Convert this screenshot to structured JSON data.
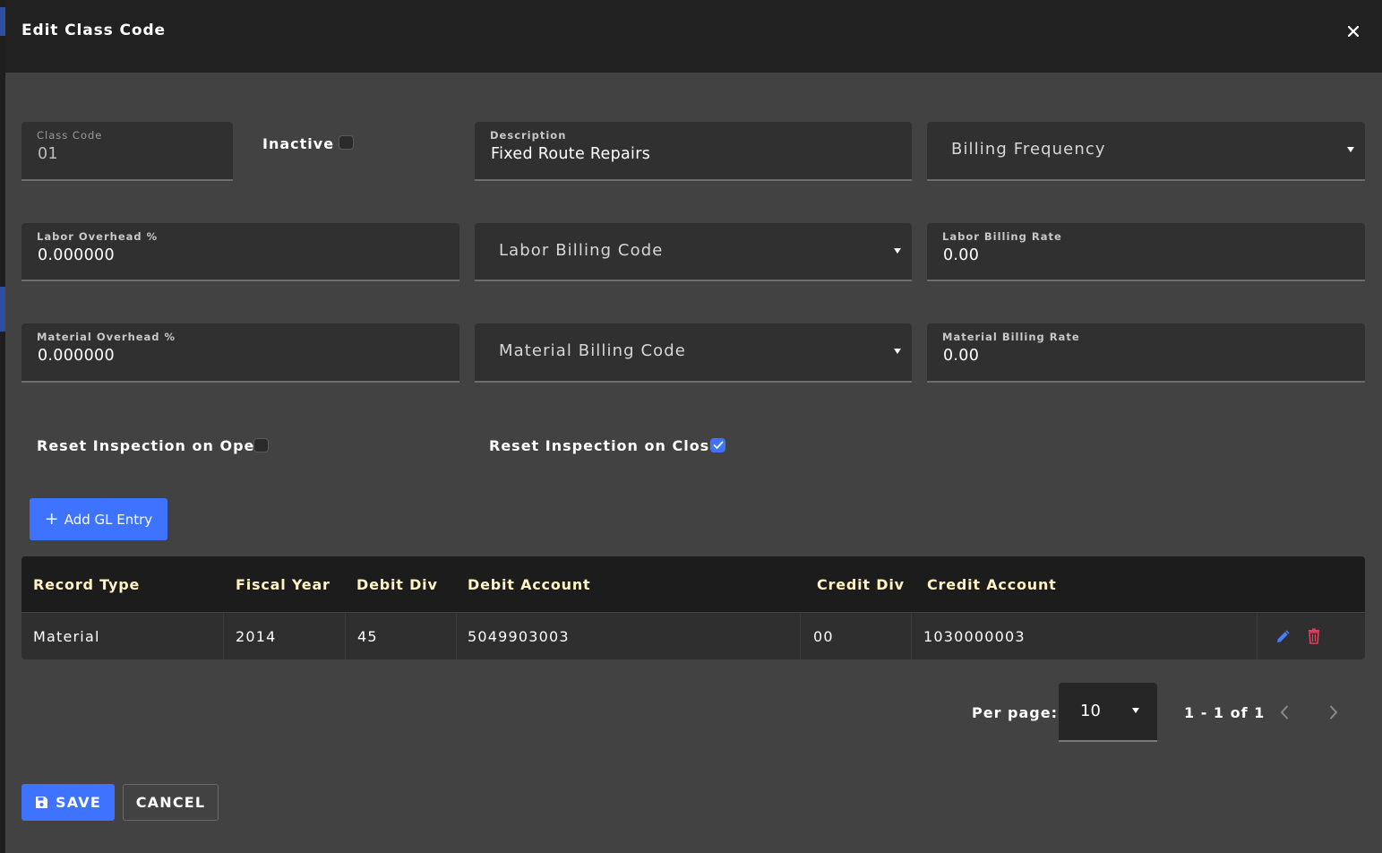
{
  "dialog": {
    "title": "Edit Class Code"
  },
  "form": {
    "class_code": {
      "label": "Class Code",
      "value": "01"
    },
    "inactive": {
      "label": "Inactive",
      "checked": false
    },
    "description": {
      "label": "Description",
      "value": "Fixed Route Repairs"
    },
    "billing_frequency": {
      "placeholder": "Billing Frequency"
    },
    "labor_overhead": {
      "label": "Labor Overhead %",
      "value": "0.000000"
    },
    "labor_billing_code": {
      "placeholder": "Labor Billing Code"
    },
    "labor_billing_rate": {
      "label": "Labor Billing Rate",
      "value": "0.00"
    },
    "material_overhead": {
      "label": "Material Overhead %",
      "value": "0.000000"
    },
    "material_billing_code": {
      "placeholder": "Material Billing Code"
    },
    "material_billing_rate": {
      "label": "Material Billing Rate",
      "value": "0.00"
    },
    "reset_on_open": {
      "label": "Reset Inspection on Open",
      "checked": false
    },
    "reset_on_close": {
      "label": "Reset Inspection on Close",
      "checked": true
    }
  },
  "gl": {
    "add_button": "Add GL Entry",
    "columns": [
      "Record Type",
      "Fiscal Year",
      "Debit Div",
      "Debit Account",
      "Credit Div",
      "Credit Account"
    ],
    "rows": [
      {
        "record_type": "Material",
        "fiscal_year": "2014",
        "debit_div": "45",
        "debit_account": "5049903003",
        "credit_div": "00",
        "credit_account": "1030000003"
      }
    ]
  },
  "pagination": {
    "per_page_label": "Per page:",
    "per_page_value": "10",
    "range": "1 - 1 of 1"
  },
  "footer": {
    "save": "SAVE",
    "cancel": "CANCEL"
  },
  "colors": {
    "accent": "#3d73ff",
    "delete": "#e0415e",
    "header_text": "#fff3c4"
  }
}
